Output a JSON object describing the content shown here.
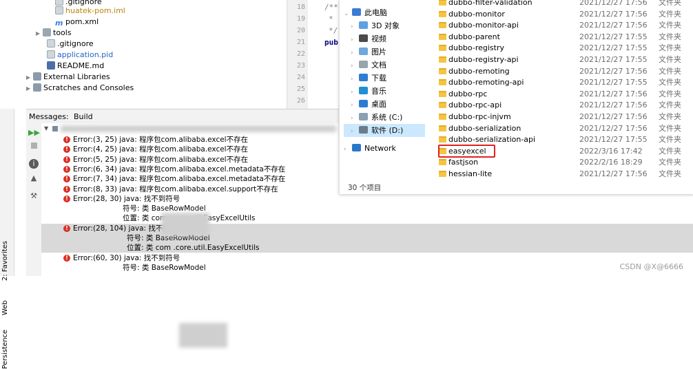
{
  "ide": {
    "tree": [
      {
        "label": ".gitignore",
        "kind": "file",
        "partial": true
      },
      {
        "label": "huatek-pom.iml",
        "kind": "file",
        "color": "#b8860b"
      },
      {
        "label": "pom.xml",
        "kind": "m"
      },
      {
        "label": "tools",
        "kind": "folder",
        "collapsed": true
      },
      {
        "label": ".gitignore",
        "kind": "file"
      },
      {
        "label": "application.pid",
        "kind": "file",
        "color": "#2463c6"
      },
      {
        "label": "README.md",
        "kind": "md"
      },
      {
        "label": "External Libraries",
        "kind": "lib",
        "collapsed": true
      },
      {
        "label": "Scratches and Consoles",
        "kind": "lib",
        "collapsed": true
      }
    ],
    "editor": {
      "line_numbers": [
        "18",
        "19",
        "20",
        "21",
        "22",
        "23",
        "24",
        "25",
        "26"
      ],
      "code_snippets": [
        "/**",
        "*",
        "*/",
        "pub"
      ]
    },
    "messages_tab": "Messages:",
    "build_tab": "Build",
    "side_labels": [
      "2: Favorites",
      "Web",
      "Persistence"
    ],
    "messages": [
      {
        "kind": "error",
        "text": "Error:(3, 25)  java: 程序包com.alibaba.excel不存在"
      },
      {
        "kind": "error",
        "text": "Error:(4, 25)  java: 程序包com.alibaba.excel不存在"
      },
      {
        "kind": "error",
        "text": "Error:(5, 25)  java: 程序包com.alibaba.excel不存在"
      },
      {
        "kind": "error",
        "text": "Error:(6, 34)  java: 程序包com.alibaba.excel.metadata不存在"
      },
      {
        "kind": "error",
        "text": "Error:(7, 34)  java: 程序包com.alibaba.excel.metadata不存在"
      },
      {
        "kind": "error",
        "text": "Error:(8, 33)  java: 程序包com.alibaba.excel.support不存在"
      },
      {
        "kind": "error",
        "text": "Error:(28, 30)  java: 找不到符号"
      },
      {
        "kind": "detail",
        "text": "符号:   类 BaseRowModel"
      },
      {
        "kind": "detail",
        "text": "位置: 类 com                     .core.util.EasyExcelUtils"
      },
      {
        "kind": "error",
        "text": "Error:(28, 104)  java: 找不到符号",
        "selected": true
      },
      {
        "kind": "detail",
        "text": "符号:   类 BaseRowModel",
        "selected": true
      },
      {
        "kind": "detail",
        "text": "位置: 类 com                     .core.util.EasyExcelUtils",
        "selected": true
      },
      {
        "kind": "error",
        "text": "Error:(60, 30)  java: 找不到符号"
      },
      {
        "kind": "detail",
        "text": "符号:   类 BaseRowModel"
      }
    ]
  },
  "explorer": {
    "nav": [
      {
        "label": "此电脑",
        "icon": "pc-icon",
        "color": "#3a7bd5"
      },
      {
        "label": "3D 对象",
        "icon": "cube-icon",
        "color": "#5fa0e0"
      },
      {
        "label": "视频",
        "icon": "video-icon",
        "color": "#4a4a4a"
      },
      {
        "label": "图片",
        "icon": "picture-icon",
        "color": "#6fa8dc"
      },
      {
        "label": "文档",
        "icon": "document-icon",
        "color": "#9aa4ad"
      },
      {
        "label": "下载",
        "icon": "download-icon",
        "color": "#2f7dd1"
      },
      {
        "label": "音乐",
        "icon": "music-icon",
        "color": "#1f8fd6"
      },
      {
        "label": "桌面",
        "icon": "desktop-icon",
        "color": "#2b7cd3"
      },
      {
        "label": "系统 (C:)",
        "icon": "drive-c-icon",
        "color": "#8aa1b4"
      },
      {
        "label": "软件 (D:)",
        "icon": "drive-d-icon",
        "color": "#6b7d8d",
        "selected": true
      },
      {
        "label": "Network",
        "icon": "network-icon",
        "color": "#2a78c9"
      }
    ],
    "files": [
      {
        "name": "dubbo-filter-validation",
        "date": "2021/12/27 17:56",
        "type": "文件夹"
      },
      {
        "name": "dubbo-monitor",
        "date": "2021/12/27 17:56",
        "type": "文件夹"
      },
      {
        "name": "dubbo-monitor-api",
        "date": "2021/12/27 17:56",
        "type": "文件夹"
      },
      {
        "name": "dubbo-parent",
        "date": "2021/12/27 17:55",
        "type": "文件夹"
      },
      {
        "name": "dubbo-registry",
        "date": "2021/12/27 17:55",
        "type": "文件夹"
      },
      {
        "name": "dubbo-registry-api",
        "date": "2021/12/27 17:55",
        "type": "文件夹"
      },
      {
        "name": "dubbo-remoting",
        "date": "2021/12/27 17:56",
        "type": "文件夹"
      },
      {
        "name": "dubbo-remoting-api",
        "date": "2021/12/27 17:55",
        "type": "文件夹"
      },
      {
        "name": "dubbo-rpc",
        "date": "2021/12/27 17:56",
        "type": "文件夹"
      },
      {
        "name": "dubbo-rpc-api",
        "date": "2021/12/27 17:56",
        "type": "文件夹"
      },
      {
        "name": "dubbo-rpc-injvm",
        "date": "2021/12/27 17:56",
        "type": "文件夹"
      },
      {
        "name": "dubbo-serialization",
        "date": "2021/12/27 17:56",
        "type": "文件夹"
      },
      {
        "name": "dubbo-serialization-api",
        "date": "2021/12/27 17:55",
        "type": "文件夹"
      },
      {
        "name": "easyexcel",
        "date": "2022/3/16 17:42",
        "type": "文件夹",
        "highlighted": true
      },
      {
        "name": "fastjson",
        "date": "2022/2/16 18:29",
        "type": "文件夹"
      },
      {
        "name": "hessian-lite",
        "date": "2021/12/27 17:56",
        "type": "文件夹"
      }
    ],
    "item_count": "30 个项目"
  },
  "watermark": "CSDN @X@6666"
}
